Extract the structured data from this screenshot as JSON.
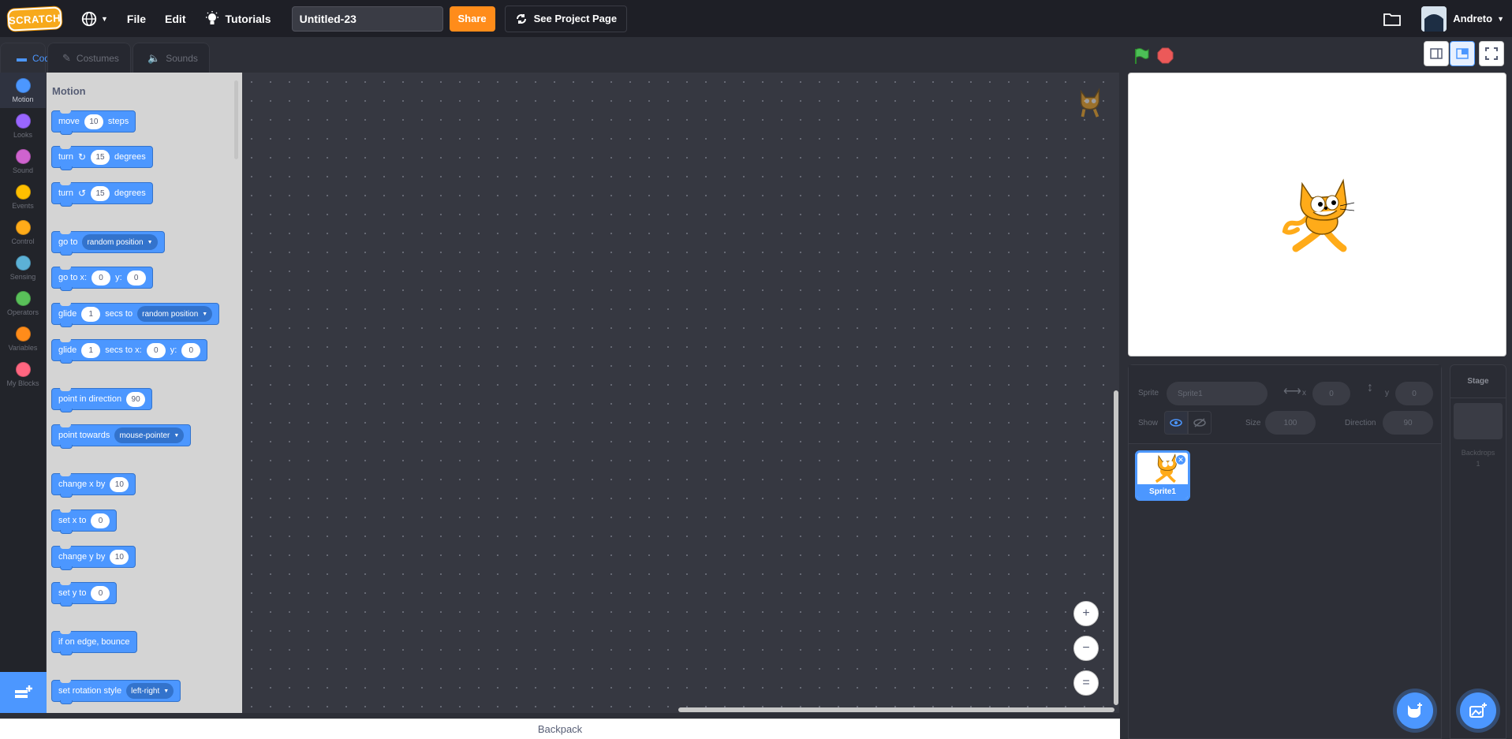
{
  "menubar": {
    "logo": "SCRATCH",
    "file": "File",
    "edit": "Edit",
    "tutorials": "Tutorials",
    "project_title": "Untitled-23",
    "share": "Share",
    "see_project_page": "See Project Page",
    "username": "Andreto"
  },
  "tabs": {
    "code": "Code",
    "costumes": "Costumes",
    "sounds": "Sounds"
  },
  "categories": [
    {
      "label": "Motion",
      "color": "#4c97ff"
    },
    {
      "label": "Looks",
      "color": "#9966ff"
    },
    {
      "label": "Sound",
      "color": "#cf63cf"
    },
    {
      "label": "Events",
      "color": "#ffbf00"
    },
    {
      "label": "Control",
      "color": "#ffab19"
    },
    {
      "label": "Sensing",
      "color": "#5cb1d6"
    },
    {
      "label": "Operators",
      "color": "#59c059"
    },
    {
      "label": "Variables",
      "color": "#ff8c1a"
    },
    {
      "label": "My Blocks",
      "color": "#ff6680"
    }
  ],
  "palette": {
    "heading": "Motion",
    "move": {
      "a": "move",
      "n": "10",
      "b": "steps"
    },
    "turn_cw": {
      "a": "turn",
      "n": "15",
      "b": "degrees"
    },
    "turn_ccw": {
      "a": "turn",
      "n": "15",
      "b": "degrees"
    },
    "goto": {
      "a": "go to",
      "opt": "random position"
    },
    "goto_xy": {
      "a": "go to x:",
      "x": "0",
      "b": "y:",
      "y": "0"
    },
    "glide_to": {
      "a": "glide",
      "n": "1",
      "b": "secs to",
      "opt": "random position"
    },
    "glide_xy": {
      "a": "glide",
      "n": "1",
      "b": "secs to x:",
      "x": "0",
      "c": "y:",
      "y": "0"
    },
    "point_dir": {
      "a": "point in direction",
      "n": "90"
    },
    "point_towards": {
      "a": "point towards",
      "opt": "mouse-pointer"
    },
    "change_x": {
      "a": "change x by",
      "n": "10"
    },
    "set_x": {
      "a": "set x to",
      "n": "0"
    },
    "change_y": {
      "a": "change y by",
      "n": "10"
    },
    "set_y": {
      "a": "set y to",
      "n": "0"
    },
    "bounce": {
      "a": "if on edge, bounce"
    },
    "rot_style": {
      "a": "set rotation style",
      "opt": "left-right"
    }
  },
  "workspace": {
    "zoom_in": "+",
    "zoom_out": "−",
    "zoom_reset": "="
  },
  "backpack": "Backpack",
  "sprite_info": {
    "sprite_label": "Sprite",
    "sprite_name": "Sprite1",
    "x_label": "x",
    "x_value": "0",
    "y_label": "y",
    "y_value": "0",
    "show_label": "Show",
    "size_label": "Size",
    "size_value": "100",
    "direction_label": "Direction",
    "direction_value": "90"
  },
  "sprites": [
    {
      "name": "Sprite1"
    }
  ],
  "stage_pane": {
    "title": "Stage",
    "backdrops_label": "Backdrops",
    "backdrops_count": "1"
  }
}
